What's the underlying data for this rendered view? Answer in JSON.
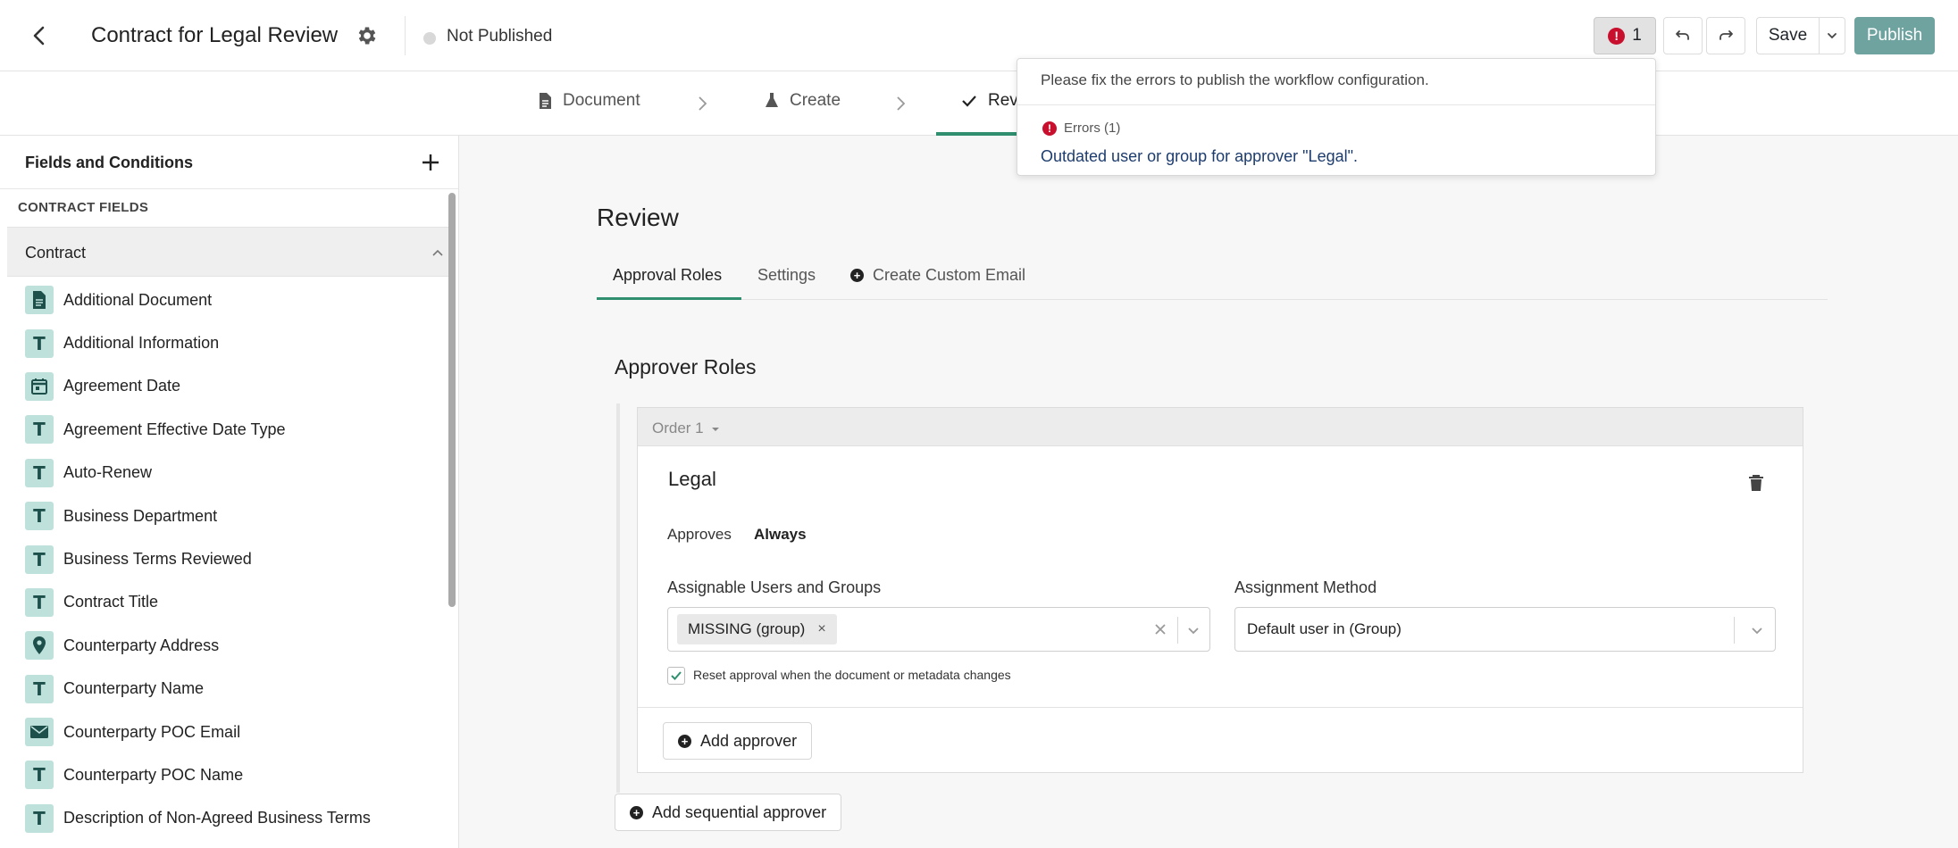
{
  "header": {
    "title": "Contract for Legal Review",
    "status": "Not Published",
    "error_count": "1",
    "error_badge_symbol": "!",
    "save_label": "Save",
    "publish_label": "Publish"
  },
  "steps": [
    {
      "label": "Document",
      "icon": "document-icon"
    },
    {
      "label": "Create",
      "icon": "flask-icon"
    },
    {
      "label": "Revi",
      "icon": "check-icon",
      "active": true
    }
  ],
  "error_popover": {
    "message": "Please fix the errors to publish the workflow configuration.",
    "errors_header": "Errors (1)",
    "error_text": "Outdated user or group for approver \"Legal\"."
  },
  "sidebar": {
    "title": "Fields and Conditions",
    "section": "CONTRACT FIELDS",
    "group": "Contract",
    "items": [
      {
        "label": "Additional Document",
        "icon": "document-icon"
      },
      {
        "label": "Additional Information",
        "icon": "text-icon",
        "glyph": "T"
      },
      {
        "label": "Agreement Date",
        "icon": "calendar-icon"
      },
      {
        "label": "Agreement Effective Date Type",
        "icon": "text-icon",
        "glyph": "T"
      },
      {
        "label": "Auto-Renew",
        "icon": "text-icon",
        "glyph": "T"
      },
      {
        "label": "Business Department",
        "icon": "text-icon",
        "glyph": "T"
      },
      {
        "label": "Business Terms Reviewed",
        "icon": "text-icon",
        "glyph": "T"
      },
      {
        "label": "Contract Title",
        "icon": "text-icon",
        "glyph": "T"
      },
      {
        "label": "Counterparty Address",
        "icon": "location-pin-icon"
      },
      {
        "label": "Counterparty Name",
        "icon": "text-icon",
        "glyph": "T"
      },
      {
        "label": "Counterparty POC Email",
        "icon": "email-icon"
      },
      {
        "label": "Counterparty POC Name",
        "icon": "text-icon",
        "glyph": "T"
      },
      {
        "label": "Description of Non-Agreed Business Terms",
        "icon": "text-icon",
        "glyph": "T"
      }
    ]
  },
  "main": {
    "title": "Review",
    "tabs": [
      {
        "label": "Approval Roles",
        "active": true
      },
      {
        "label": "Settings"
      },
      {
        "label": "Create Custom Email"
      }
    ],
    "section_title": "Approver Roles",
    "order_label": "Order 1",
    "role": {
      "name": "Legal",
      "approves_label": "Approves",
      "approves_value": "Always",
      "users_label": "Assignable Users and Groups",
      "users_chip": "MISSING (group)",
      "chip_remove": "×",
      "method_label": "Assignment Method",
      "method_value": "Default user in (Group)",
      "reset_label": "Reset approval when the document or metadata changes",
      "reset_checked": true
    },
    "add_approver_label": "Add approver",
    "add_sequential_label": "Add sequential approver"
  },
  "colors": {
    "accent": "#2f8f6f",
    "publish_bg": "#6fa3a0",
    "error_red": "#c8102e",
    "icon_bg": "#bfe1db",
    "icon_fg": "#1d4f4b"
  }
}
